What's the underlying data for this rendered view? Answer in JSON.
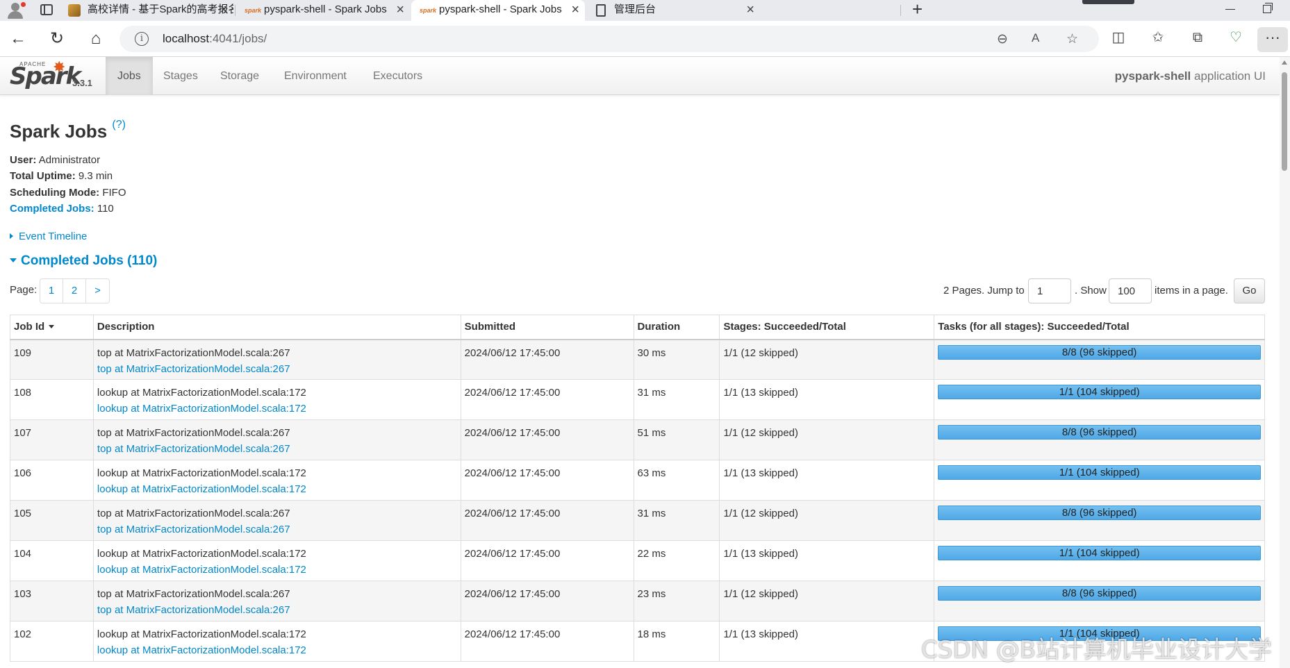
{
  "browser": {
    "tabs": [
      {
        "title": "高校详情 - 基于Spark的高考报名",
        "icon": "university-favicon",
        "active": false
      },
      {
        "title": "pyspark-shell - Spark Jobs",
        "icon": "spark-favicon",
        "active": false
      },
      {
        "title": "pyspark-shell - Spark Jobs",
        "icon": "spark-favicon",
        "active": true
      },
      {
        "title": "管理后台",
        "icon": "document-favicon",
        "active": false
      }
    ],
    "url_host": "localhost",
    "url_rest": ":4041/jobs/"
  },
  "spark": {
    "version": "3.3.1",
    "nav": [
      "Jobs",
      "Stages",
      "Storage",
      "Environment",
      "Executors"
    ],
    "app_name": "pyspark-shell",
    "app_suffix": "application UI"
  },
  "page": {
    "title": "Spark Jobs",
    "help": "(?)",
    "user_label": "User:",
    "user": "Administrator",
    "uptime_label": "Total Uptime:",
    "uptime": "9.3 min",
    "sched_label": "Scheduling Mode:",
    "sched": "FIFO",
    "completed_label": "Completed Jobs:",
    "completed": "110",
    "event_timeline": "Event Timeline",
    "completed_header": "Completed Jobs (110)"
  },
  "pagination": {
    "label": "Page:",
    "pages": [
      "1",
      "2",
      ">"
    ],
    "pages_text": "2 Pages. Jump to",
    "jump_value": "1",
    "show_text": ". Show",
    "show_value": "100",
    "items_text": "items in a page.",
    "go": "Go"
  },
  "table": {
    "headers": [
      "Job Id",
      "Description",
      "Submitted",
      "Duration",
      "Stages: Succeeded/Total",
      "Tasks (for all stages): Succeeded/Total"
    ],
    "rows": [
      {
        "id": "109",
        "desc": "top at MatrixFactorizationModel.scala:267",
        "link": "top at MatrixFactorizationModel.scala:267",
        "submitted": "2024/06/12 17:45:00",
        "duration": "30 ms",
        "stages": "1/1 (12 skipped)",
        "tasks": "8/8 (96 skipped)"
      },
      {
        "id": "108",
        "desc": "lookup at MatrixFactorizationModel.scala:172",
        "link": "lookup at MatrixFactorizationModel.scala:172",
        "submitted": "2024/06/12 17:45:00",
        "duration": "31 ms",
        "stages": "1/1 (13 skipped)",
        "tasks": "1/1 (104 skipped)"
      },
      {
        "id": "107",
        "desc": "top at MatrixFactorizationModel.scala:267",
        "link": "top at MatrixFactorizationModel.scala:267",
        "submitted": "2024/06/12 17:45:00",
        "duration": "51 ms",
        "stages": "1/1 (12 skipped)",
        "tasks": "8/8 (96 skipped)"
      },
      {
        "id": "106",
        "desc": "lookup at MatrixFactorizationModel.scala:172",
        "link": "lookup at MatrixFactorizationModel.scala:172",
        "submitted": "2024/06/12 17:45:00",
        "duration": "63 ms",
        "stages": "1/1 (13 skipped)",
        "tasks": "1/1 (104 skipped)"
      },
      {
        "id": "105",
        "desc": "top at MatrixFactorizationModel.scala:267",
        "link": "top at MatrixFactorizationModel.scala:267",
        "submitted": "2024/06/12 17:45:00",
        "duration": "31 ms",
        "stages": "1/1 (12 skipped)",
        "tasks": "8/8 (96 skipped)"
      },
      {
        "id": "104",
        "desc": "lookup at MatrixFactorizationModel.scala:172",
        "link": "lookup at MatrixFactorizationModel.scala:172",
        "submitted": "2024/06/12 17:45:00",
        "duration": "22 ms",
        "stages": "1/1 (13 skipped)",
        "tasks": "1/1 (104 skipped)"
      },
      {
        "id": "103",
        "desc": "top at MatrixFactorizationModel.scala:267",
        "link": "top at MatrixFactorizationModel.scala:267",
        "submitted": "2024/06/12 17:45:00",
        "duration": "23 ms",
        "stages": "1/1 (12 skipped)",
        "tasks": "8/8 (96 skipped)"
      },
      {
        "id": "102",
        "desc": "lookup at MatrixFactorizationModel.scala:172",
        "link": "lookup at MatrixFactorizationModel.scala:172",
        "submitted": "2024/06/12 17:45:00",
        "duration": "18 ms",
        "stages": "1/1 (13 skipped)",
        "tasks": "1/1 (104 skipped)"
      }
    ]
  },
  "watermark": "CSDN @B站计算机毕业设计大学"
}
